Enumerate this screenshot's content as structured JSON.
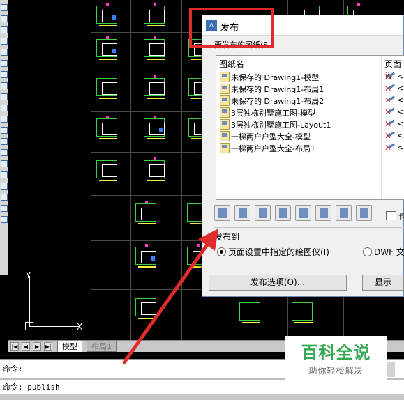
{
  "dialog": {
    "title": "发布",
    "sheets_label": "要发布的图纸(S",
    "columns": {
      "name": "图纸名",
      "page": "页面设"
    },
    "sheets": [
      {
        "name": "未保存的 Drawing1-模型",
        "page": "<"
      },
      {
        "name": "未保存的 Drawing1-布局1",
        "page": "<"
      },
      {
        "name": "未保存的 Drawing1-布局2",
        "page": "<"
      },
      {
        "name": "3层独栋别墅施工图-模型",
        "page": "<"
      },
      {
        "name": "3层独栋别墅施工图-Layout1",
        "page": "<"
      },
      {
        "name": "一梯两户户型大全-模型",
        "page": "<"
      },
      {
        "name": "一梯两户户型大全-布局1",
        "page": "<"
      }
    ],
    "include_checkbox_label": "包",
    "publish_to_label": "发布到",
    "radio_plotter": "页面设置中指定的绘图仪(I)",
    "radio_dwf": "DWF 文件",
    "publish_options_button": "发布选项(O)...",
    "show_button": "显示"
  },
  "tabs": {
    "model": "模型",
    "layout1": "布局1"
  },
  "command": {
    "line1": "命令:",
    "line2": "命令: publish"
  },
  "ucs": {
    "y": "Y",
    "x": "X"
  },
  "watermark": {
    "title": "百科全说",
    "subtitle": "助你轻松解决"
  },
  "colors": {
    "highlight": "#e22b2b",
    "accent": "#35a852"
  }
}
